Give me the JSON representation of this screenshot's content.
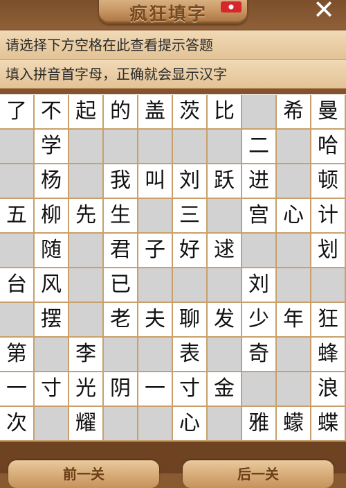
{
  "header": {
    "title": "疯狂填字"
  },
  "hints": {
    "line1": "请选择下方空格在此查看提示答题",
    "line2": "填入拼音首字母，正确就会显示汉字"
  },
  "grid": [
    [
      "了",
      "不",
      "起",
      "的",
      "盖",
      "茨",
      "比",
      "",
      "希",
      "曼"
    ],
    [
      "",
      "学",
      "",
      "",
      "",
      "",
      "",
      "二",
      "",
      "哈"
    ],
    [
      "",
      "杨",
      "",
      "我",
      "叫",
      "刘",
      "跃",
      "进",
      "",
      "顿"
    ],
    [
      "五",
      "柳",
      "先",
      "生",
      "",
      "三",
      "",
      "宫",
      "心",
      "计"
    ],
    [
      "",
      "随",
      "",
      "君",
      "子",
      "好",
      "逑",
      "",
      "",
      "划"
    ],
    [
      "台",
      "风",
      "",
      "已",
      "",
      "",
      "",
      "刘",
      "",
      ""
    ],
    [
      "",
      "摆",
      "",
      "老",
      "夫",
      "聊",
      "发",
      "少",
      "年",
      "狂"
    ],
    [
      "第",
      "",
      "李",
      "",
      "",
      "表",
      "",
      "奇",
      "",
      "蜂"
    ],
    [
      "一",
      "寸",
      "光",
      "阴",
      "一",
      "寸",
      "金",
      "",
      "",
      "浪"
    ],
    [
      "次",
      "",
      "耀",
      "",
      "",
      "心",
      "",
      "雅",
      "蠓",
      "蝶"
    ]
  ],
  "footer": {
    "prev_label": "前一关",
    "next_label": "后一关"
  }
}
